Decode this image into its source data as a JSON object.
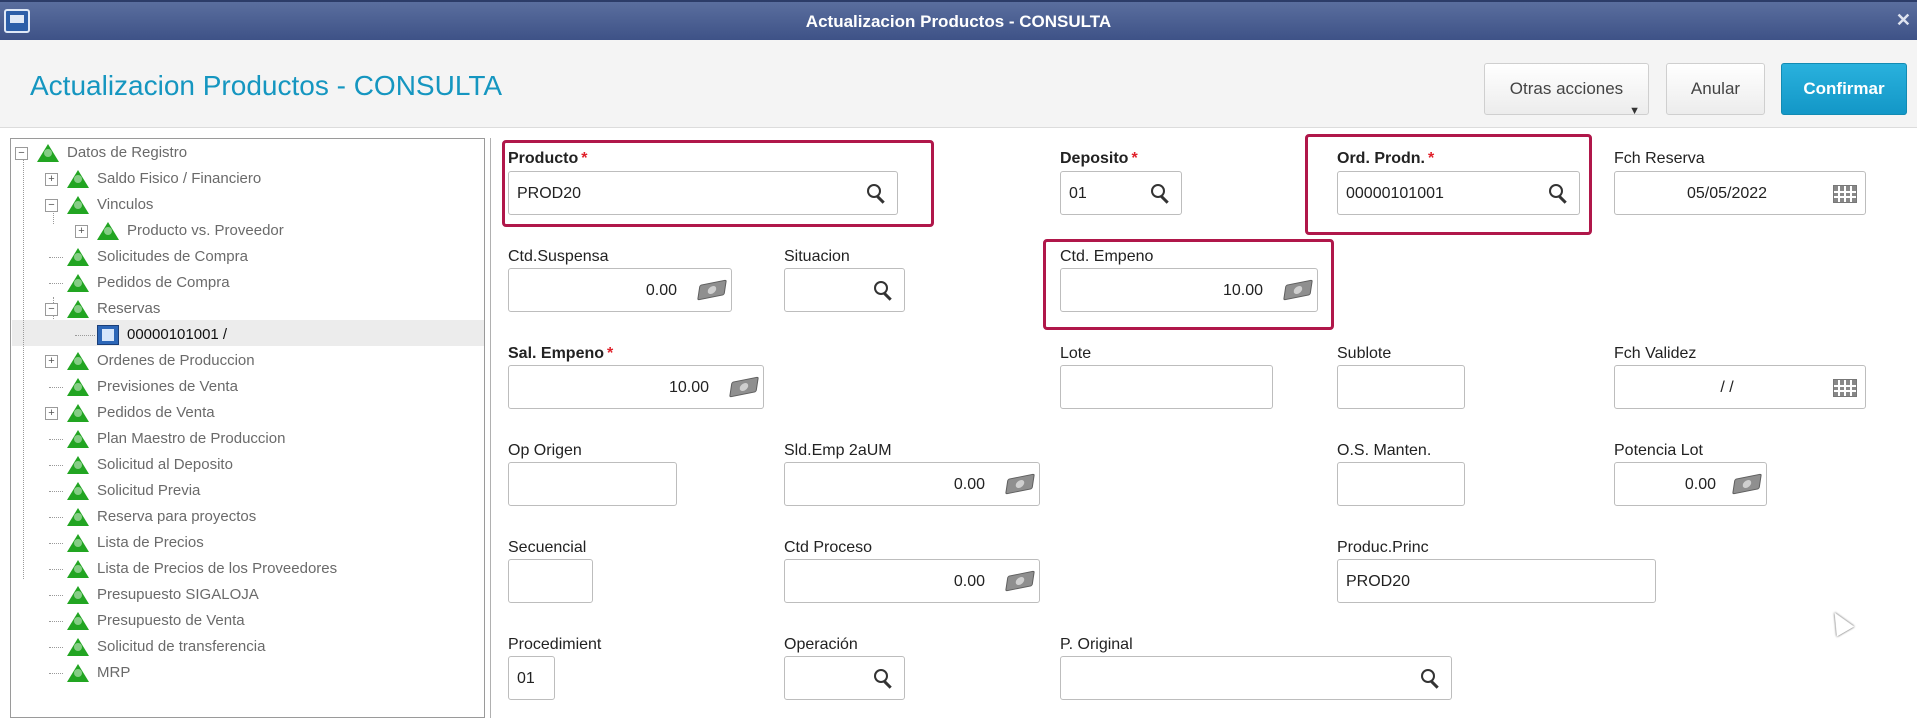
{
  "window": {
    "title": "Actualizacion Productos - CONSULTA",
    "close_glyph": "✕"
  },
  "header": {
    "title": "Actualizacion Productos - CONSULTA",
    "buttons": {
      "otras": "Otras acciones",
      "anular": "Anular",
      "confirmar": "Confirmar"
    }
  },
  "tree": {
    "items": [
      {
        "label": "Datos de Registro",
        "expander": "−"
      },
      {
        "label": "Saldo Fisico / Financiero",
        "expander": "+"
      },
      {
        "label": "Vinculos",
        "expander": "−"
      },
      {
        "label": "Producto vs. Proveedor",
        "expander": "+"
      },
      {
        "label": "Solicitudes de Compra"
      },
      {
        "label": "Pedidos de Compra"
      },
      {
        "label": "Reservas",
        "expander": "−"
      },
      {
        "label": "00000101001     /",
        "selected": true
      },
      {
        "label": "Ordenes de Produccion",
        "expander": "+"
      },
      {
        "label": "Previsiones de Venta"
      },
      {
        "label": "Pedidos de Venta",
        "expander": "+"
      },
      {
        "label": "Plan Maestro de Produccion"
      },
      {
        "label": "Solicitud al Deposito"
      },
      {
        "label": "Solicitud Previa"
      },
      {
        "label": "Reserva para proyectos"
      },
      {
        "label": "Lista de Precios"
      },
      {
        "label": "Lista de Precios de los Proveedores"
      },
      {
        "label": "Presupuesto SIGALOJA"
      },
      {
        "label": "Presupuesto de Venta"
      },
      {
        "label": "Solicitud de transferencia"
      },
      {
        "label": "MRP"
      }
    ]
  },
  "form": {
    "required_mark": "*",
    "producto": {
      "label": "Producto",
      "value": "PROD20"
    },
    "deposito": {
      "label": "Deposito",
      "value": "01"
    },
    "ord_prodn": {
      "label": "Ord. Prodn.",
      "value": "00000101001"
    },
    "fch_reserva": {
      "label": "Fch Reserva",
      "value": "05/05/2022"
    },
    "ctd_suspensa": {
      "label": "Ctd.Suspensa",
      "value": "0.00"
    },
    "situacion": {
      "label": "Situacion",
      "value": ""
    },
    "ctd_empeno": {
      "label": "Ctd. Empeno",
      "value": "10.00"
    },
    "sal_empeno": {
      "label": "Sal. Empeno",
      "value": "10.00"
    },
    "lote": {
      "label": "Lote",
      "value": ""
    },
    "sublote": {
      "label": "Sublote",
      "value": ""
    },
    "fch_validez": {
      "label": "Fch Validez",
      "value": "/ /"
    },
    "op_origen": {
      "label": "Op Origen",
      "value": ""
    },
    "sld_emp_2aum": {
      "label": "Sld.Emp 2aUM",
      "value": "0.00"
    },
    "os_manten": {
      "label": "O.S. Manten.",
      "value": ""
    },
    "potencia_lot": {
      "label": "Potencia Lot",
      "value": "0.00"
    },
    "secuencial": {
      "label": "Secuencial",
      "value": ""
    },
    "ctd_proceso": {
      "label": "Ctd Proceso",
      "value": "0.00"
    },
    "produc_princ": {
      "label": "Produc.Princ",
      "value": "PROD20"
    },
    "procedimient": {
      "label": "Procedimient",
      "value": "01"
    },
    "operacion": {
      "label": "Operación",
      "value": ""
    },
    "p_original": {
      "label": "P. Original",
      "value": ""
    }
  }
}
